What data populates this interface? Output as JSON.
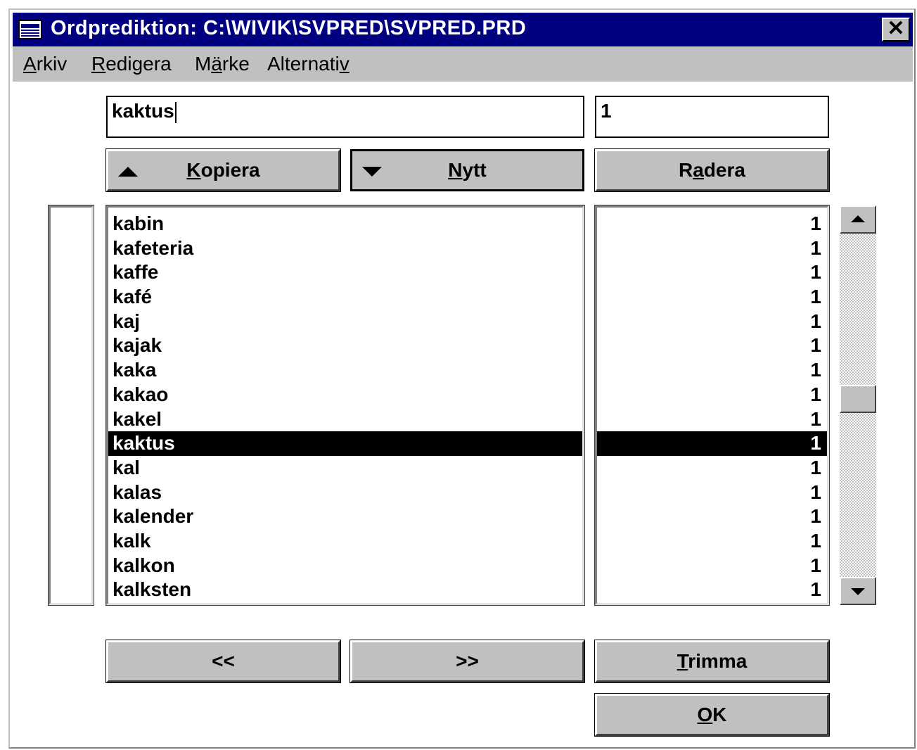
{
  "window": {
    "title": "Ordprediktion: C:\\WIVIK\\SVPRED\\SVPRED.PRD",
    "close_symbol": "✕"
  },
  "menu": {
    "items": [
      {
        "pre": "",
        "u": "A",
        "post": "rkiv"
      },
      {
        "pre": "",
        "u": "R",
        "post": "edigera"
      },
      {
        "pre": "M",
        "u": "ä",
        "post": "rke"
      },
      {
        "pre": "Alternati",
        "u": "v",
        "post": ""
      }
    ]
  },
  "editor": {
    "word_value": "kaktus",
    "frequency_value": "1"
  },
  "buttons": {
    "kopiera": {
      "u": "K",
      "post": "opiera"
    },
    "nytt": {
      "u": "N",
      "post": "ytt"
    },
    "radera": {
      "pre": "R",
      "u": "a",
      "post": "dera"
    },
    "prev": "<<",
    "next": ">>",
    "trimma": {
      "u": "T",
      "post": "rimma"
    },
    "ok": {
      "u": "O",
      "post": "K"
    }
  },
  "list": {
    "selected_index": 9,
    "words": [
      "kabin",
      "kafeteria",
      "kaffe",
      "kafé",
      "kaj",
      "kajak",
      "kaka",
      "kakao",
      "kakel",
      "kaktus",
      "kal",
      "kalas",
      "kalender",
      "kalk",
      "kalkon",
      "kalksten"
    ],
    "frequencies": [
      "1",
      "1",
      "1",
      "1",
      "1",
      "1",
      "1",
      "1",
      "1",
      "1",
      "1",
      "1",
      "1",
      "1",
      "1",
      "1"
    ]
  },
  "scrollbar": {
    "position_fraction": 0.48
  },
  "colors": {
    "titlebar": "#000080",
    "face": "#c0c0c0",
    "selection": "#000000"
  },
  "icons": [
    "system-menu-icon",
    "close-icon",
    "arrow-up-icon",
    "arrow-down-icon",
    "scroll-up-icon",
    "scroll-down-icon"
  ]
}
